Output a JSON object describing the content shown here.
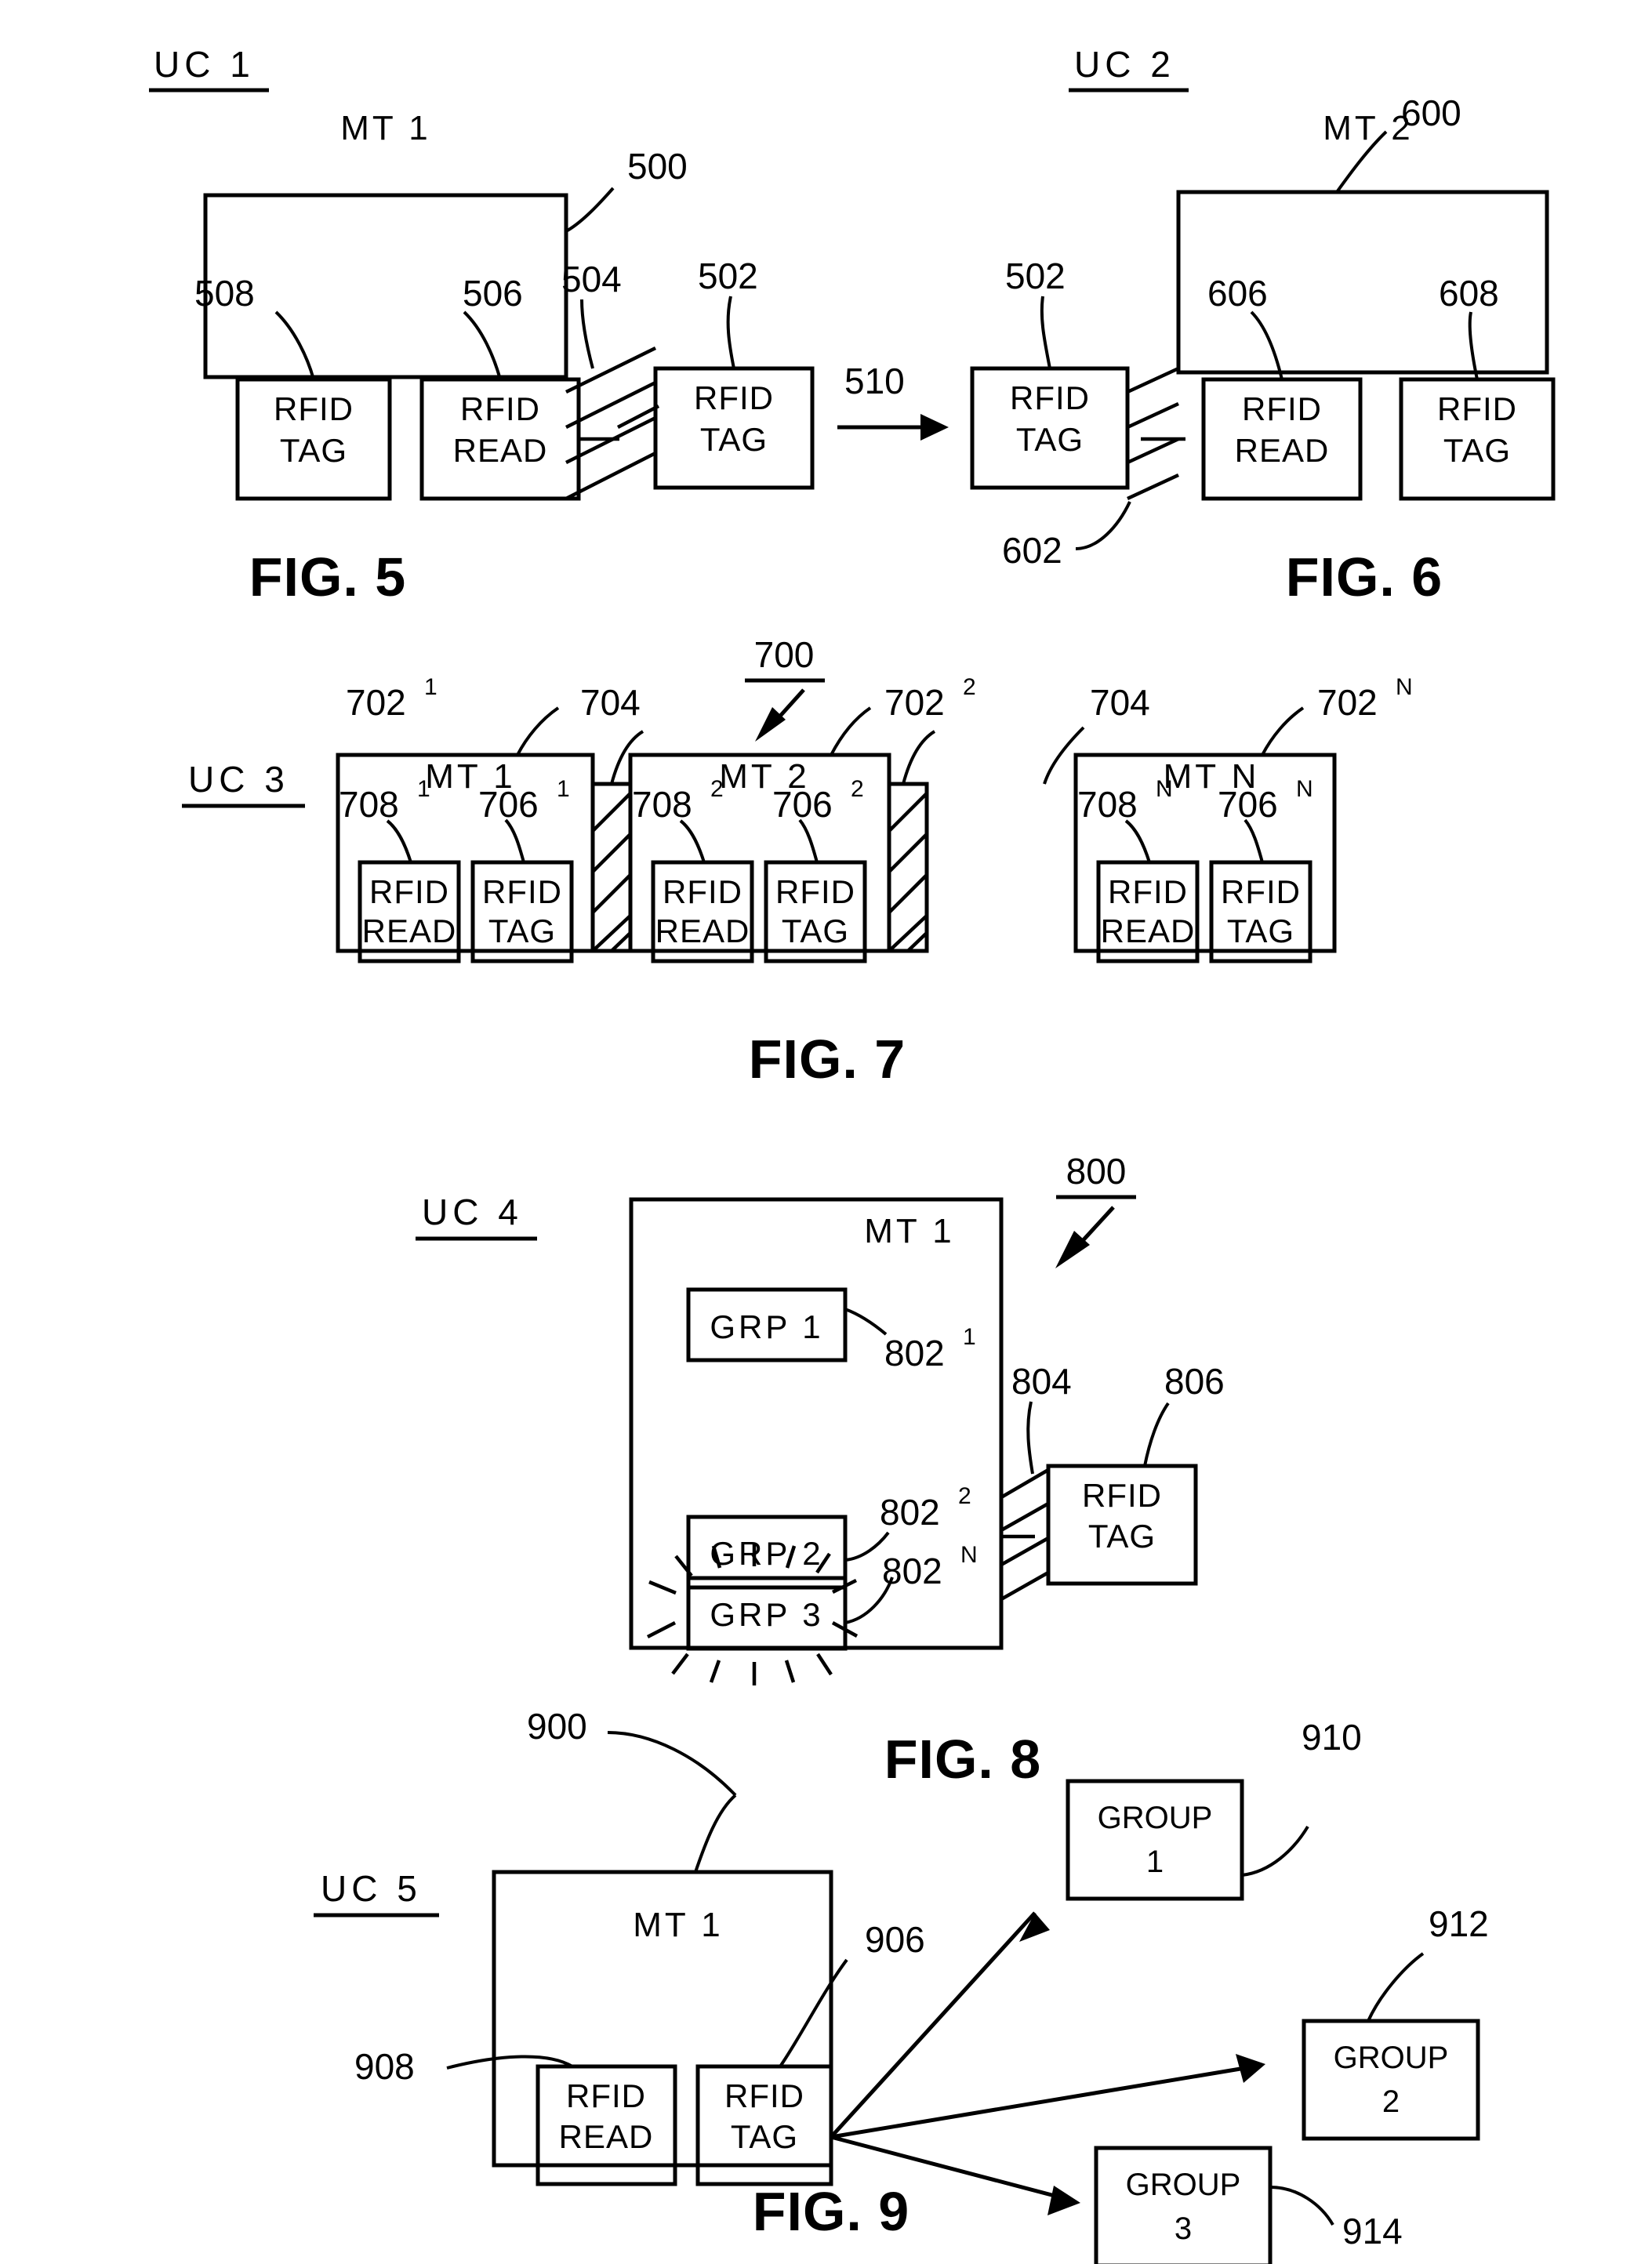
{
  "document": {
    "type": "patent-drawing-sheet",
    "figure_captions": [
      "FIG. 5",
      "FIG. 6",
      "FIG. 7",
      "FIG. 8",
      "FIG. 9"
    ]
  },
  "fig5": {
    "caption": "FIG. 5",
    "use_case_label": "UC  1",
    "terminal_label": "MT  1",
    "terminal_ref": "500",
    "inner_boxes": [
      {
        "line1": "RFID",
        "line2": "TAG",
        "ref": "508"
      },
      {
        "line1": "RFID",
        "line2": "READ",
        "ref": "506"
      }
    ],
    "external_box": {
      "line1": "RFID",
      "line2": "TAG",
      "ref": "502"
    },
    "link_ref": "504",
    "transition_ref": "510"
  },
  "fig6": {
    "caption": "FIG. 6",
    "use_case_label": "UC  2",
    "terminal_label": "MT  2",
    "terminal_ref": "600",
    "external_box": {
      "line1": "RFID",
      "line2": "TAG",
      "ref": "502"
    },
    "link_ref": "602",
    "inner_boxes": [
      {
        "line1": "RFID",
        "line2": "READ",
        "ref": "606"
      },
      {
        "line1": "RFID",
        "line2": "TAG",
        "ref": "608"
      }
    ]
  },
  "fig7": {
    "caption": "FIG. 7",
    "use_case_label": "UC  3",
    "system_ref": "700",
    "terminals": [
      {
        "label": "MT  1",
        "ref_base": "702",
        "ref_sup": "1",
        "boxes": [
          {
            "line1": "RFID",
            "line2": "READ",
            "ref_base": "708",
            "ref_sup": "1"
          },
          {
            "line1": "RFID",
            "line2": "TAG",
            "ref_base": "706",
            "ref_sup": "1"
          }
        ]
      },
      {
        "label": "MT  2",
        "ref_base": "702",
        "ref_sup": "2",
        "boxes": [
          {
            "line1": "RFID",
            "line2": "READ",
            "ref_base": "708",
            "ref_sup": "2"
          },
          {
            "line1": "RFID",
            "line2": "TAG",
            "ref_base": "706",
            "ref_sup": "2"
          }
        ]
      },
      {
        "label": "MT  N",
        "ref_base": "702",
        "ref_sup": "N",
        "boxes": [
          {
            "line1": "RFID",
            "line2": "READ",
            "ref_base": "708",
            "ref_sup": "N"
          },
          {
            "line1": "RFID",
            "line2": "TAG",
            "ref_base": "706",
            "ref_sup": "N"
          }
        ]
      }
    ],
    "coupling_refs": [
      "704",
      "704"
    ]
  },
  "fig8": {
    "caption": "FIG. 8",
    "use_case_label": "UC  4",
    "terminal_label": "MT  1",
    "system_ref": "800",
    "groups": [
      {
        "label": "GRP  1",
        "ref_base": "802",
        "ref_sup": "1"
      },
      {
        "label": "GRP  2",
        "ref_base": "802",
        "ref_sup": "2"
      },
      {
        "label": "GRP  3",
        "ref_base": "802",
        "ref_sup": "N"
      }
    ],
    "link_ref": "804",
    "external_box": {
      "line1": "RFID",
      "line2": "TAG",
      "ref": "806"
    }
  },
  "fig9": {
    "caption": "FIG. 9",
    "use_case_label": "UC  5",
    "terminal_label": "MT  1",
    "terminal_ref": "900",
    "inner_boxes": [
      {
        "line1": "RFID",
        "line2": "READ",
        "ref": "908"
      },
      {
        "line1": "RFID",
        "line2": "TAG",
        "ref": "906"
      }
    ],
    "group_boxes": [
      {
        "line1": "GROUP",
        "line2": "1",
        "ref": "910"
      },
      {
        "line1": "GROUP",
        "line2": "2",
        "ref": "912"
      },
      {
        "line1": "GROUP",
        "line2": "3",
        "ref": "914"
      }
    ]
  }
}
